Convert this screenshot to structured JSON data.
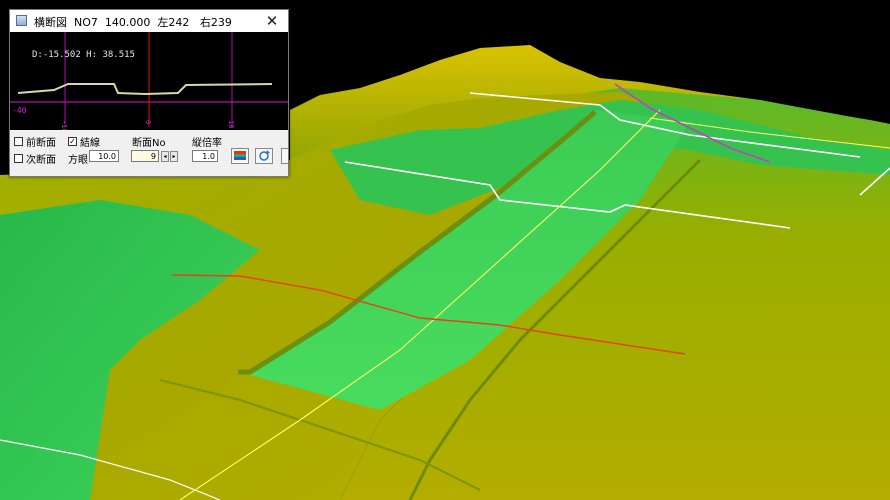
{
  "dialog": {
    "title": "横断図  NO7  140.000  左242   右239",
    "close_glyph": "✕",
    "readout": "D:-15.502  H: 38.515",
    "y_label": "-40",
    "x_ticks": [
      "-10",
      "0",
      "10"
    ]
  },
  "controls": {
    "prev_section_label": "前断面",
    "next_section_label": "次断面",
    "connect_line_label": "結線",
    "connect_line_checked": "✓",
    "grid_label": "方眼",
    "grid_value": "10.0",
    "section_no_label": "断面No",
    "section_no_value": "9",
    "spin_left": "◂",
    "spin_right": "▸",
    "vertical_ratio_label": "縦倍率",
    "vertical_ratio_value": "1.0"
  },
  "icons": {
    "color_palette": "palette-icon",
    "refresh": "refresh-icon"
  },
  "colors": {
    "terrain_green": "#2ecc4b",
    "terrain_yellow": "#b8b200",
    "section_white": "#ffffff",
    "alignment_yellow": "#ffff66",
    "line_red": "#e8401a",
    "line_magenta": "#c040c0"
  }
}
